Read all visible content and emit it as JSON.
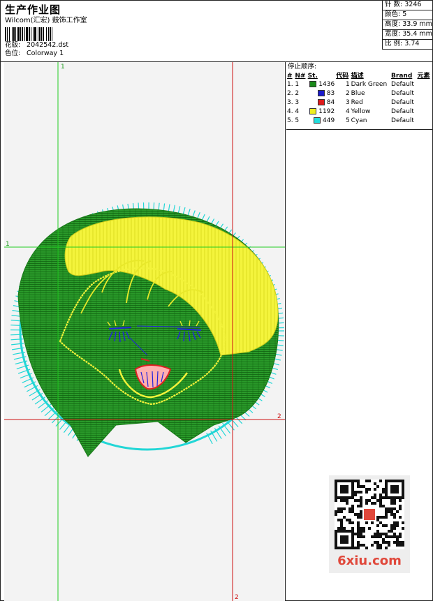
{
  "header": {
    "title": "生产作业图",
    "company": "Wilcom(汇宏) 鼓饰工作室",
    "design_label": "花版:",
    "design_value": "2042542.dst",
    "colorway_label": "色位:",
    "colorway_value": "Colorway 1"
  },
  "stats": [
    {
      "label": "针 数:",
      "value": "3246"
    },
    {
      "label": "颜色:",
      "value": "5"
    },
    {
      "label": "高度:",
      "value": "33.9 mm"
    },
    {
      "label": "宽度:",
      "value": "35.4 mm"
    },
    {
      "label": "比 例:",
      "value": "3.74"
    }
  ],
  "stop_sequence": {
    "title": "停止顺序:",
    "columns": [
      "#",
      "N#",
      "St.",
      "代码",
      "描述",
      "Brand",
      "元素"
    ],
    "rows": [
      {
        "idx": "1.",
        "n": "1",
        "color": "#1a8a1a",
        "stitches": "1436",
        "code": "1",
        "desc": "Dark Green",
        "brand": "Default"
      },
      {
        "idx": "2.",
        "n": "2",
        "color": "#1a1acc",
        "stitches": "83",
        "code": "2",
        "desc": "Blue",
        "brand": "Default"
      },
      {
        "idx": "3.",
        "n": "3",
        "color": "#dd1a1a",
        "stitches": "84",
        "code": "3",
        "desc": "Red",
        "brand": "Default"
      },
      {
        "idx": "4.",
        "n": "4",
        "color": "#eeee22",
        "stitches": "1192",
        "code": "4",
        "desc": "Yellow",
        "brand": "Default"
      },
      {
        "idx": "5.",
        "n": "5",
        "color": "#22dddd",
        "stitches": "449",
        "code": "5",
        "desc": "Cyan",
        "brand": "Default"
      }
    ]
  },
  "guides": {
    "green_top": "1",
    "green_left": "1",
    "red_right": "2",
    "red_bottom": "2"
  },
  "colors": {
    "guide_green": "#22cc22",
    "guide_red": "#cc1111",
    "thread_green": "#1f8f1f",
    "thread_yellow": "#f2f23a",
    "thread_cyan": "#22d6d6",
    "thread_blue": "#2222dd",
    "thread_red": "#dd2222"
  },
  "watermark": {
    "text": "6xiu.com"
  }
}
